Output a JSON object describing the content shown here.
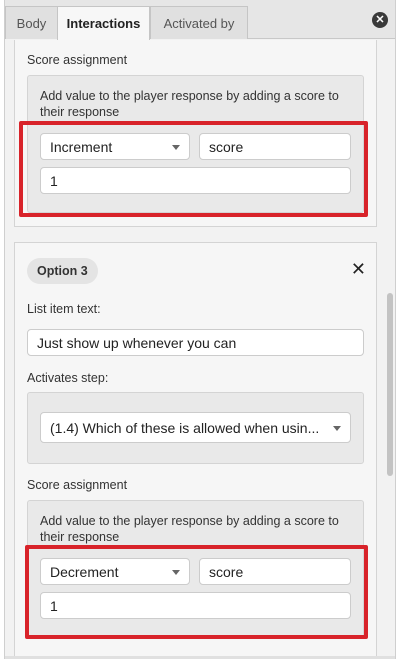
{
  "tabs": [
    {
      "label": "Body"
    },
    {
      "label": "Interactions",
      "active": true
    },
    {
      "label": "Activated by"
    }
  ],
  "close_icon": "close-circle-icon",
  "option2": {
    "score_assignment_label": "Score assignment",
    "description": "Add value to the player response by adding a score to their response",
    "operation_value": "Increment",
    "variable_value": "score",
    "amount_value": "1"
  },
  "option3": {
    "title": "Option 3",
    "list_item_text_label": "List item text:",
    "list_item_text_value": "Just show up whenever you can",
    "activates_step_label": "Activates step:",
    "activates_step_value": "(1.4) Which of these is allowed when usin...",
    "score_assignment_label": "Score assignment",
    "description": "Add value to the player response by adding a score to their response",
    "operation_value": "Decrement",
    "variable_value": "score",
    "amount_value": "1"
  },
  "colors": {
    "highlight": "#d8232a",
    "panel_bg": "#f2f2f2"
  }
}
